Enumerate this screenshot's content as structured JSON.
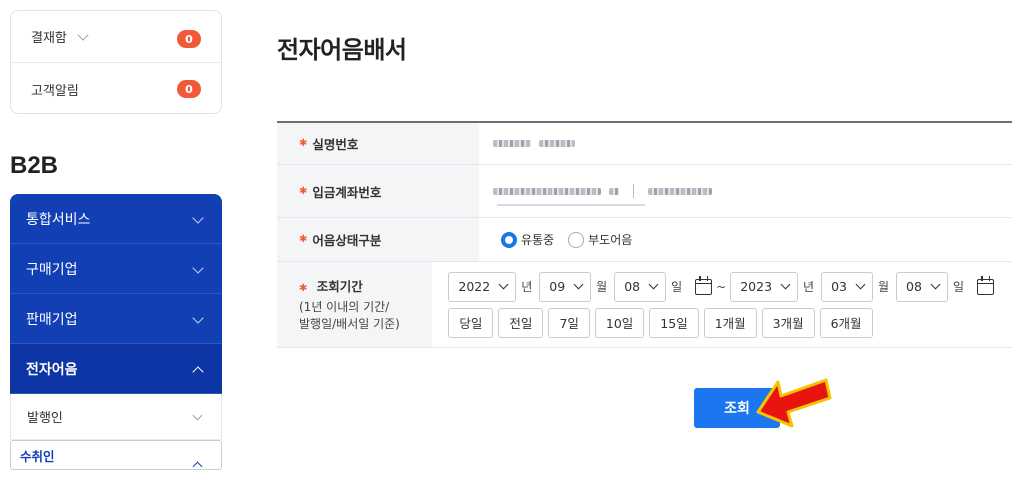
{
  "sidebar": {
    "notifications": [
      {
        "label": "결재함",
        "count": "0"
      },
      {
        "label": "고객알림",
        "count": "0"
      }
    ],
    "section_title": "B2B",
    "nav": [
      {
        "label": "통합서비스"
      },
      {
        "label": "구매기업"
      },
      {
        "label": "판매기업"
      },
      {
        "label": "전자어음"
      }
    ],
    "subnav": [
      {
        "label": "발행인"
      },
      {
        "label": "수취인"
      }
    ]
  },
  "page": {
    "title": "전자어음배서"
  },
  "form": {
    "name_label": "실명번호",
    "account_label": "입금계좌번호",
    "state_label": "어음상태구분",
    "state_options": [
      "유통중",
      "부도어음"
    ],
    "state_selected": "유통중",
    "period_label": "조회기간",
    "period_sub1": "(1년 이내의 기간/",
    "period_sub2": "발행일/배서일 기준)",
    "start": {
      "year": "2022",
      "month": "09",
      "day": "08"
    },
    "end": {
      "year": "2023",
      "month": "03",
      "day": "08"
    },
    "units": {
      "year": "년",
      "month": "월",
      "day": "일"
    },
    "tilde": "~",
    "quick_ranges": [
      "당일",
      "전일",
      "7일",
      "10일",
      "15일",
      "1개월",
      "3개월",
      "6개월"
    ]
  },
  "search_button": "조회",
  "colors": {
    "primary": "#1240b4",
    "accent": "#1b76f0",
    "badge": "#f05a3a",
    "arrow": "#e8140f"
  }
}
